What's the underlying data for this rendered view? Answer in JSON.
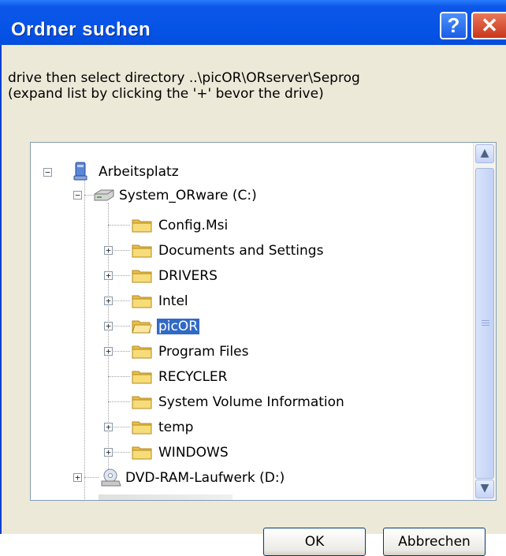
{
  "window": {
    "title": "Ordner suchen",
    "help_label": "?",
    "close_label": "✕"
  },
  "description": {
    "line1": "drive then select directory ..\\picOR\\ORserver\\Seprog",
    "line2": "(expand list by clicking the '+' bevor the drive)"
  },
  "tree": {
    "root": "Arbeitsplatz",
    "drive_c": "System_ORware (C:)",
    "folders": [
      {
        "label": "Config.Msi",
        "expandable": false
      },
      {
        "label": "Documents and Settings",
        "expandable": true
      },
      {
        "label": "DRIVERS",
        "expandable": true
      },
      {
        "label": "Intel",
        "expandable": true
      },
      {
        "label": "picOR",
        "expandable": true,
        "selected": true
      },
      {
        "label": "Program Files",
        "expandable": true
      },
      {
        "label": "RECYCLER",
        "expandable": false
      },
      {
        "label": "System Volume Information",
        "expandable": false
      },
      {
        "label": "temp",
        "expandable": true
      },
      {
        "label": "WINDOWS",
        "expandable": true
      }
    ],
    "drive_d": "DVD-RAM-Laufwerk (D:)",
    "expand_symbol": "+",
    "collapse_symbol": "−"
  },
  "buttons": {
    "ok": "OK",
    "cancel": "Abbrechen"
  },
  "colors": {
    "titlebar": "#0553e6",
    "selection": "#316ac5",
    "folder": "#f5d66b"
  }
}
